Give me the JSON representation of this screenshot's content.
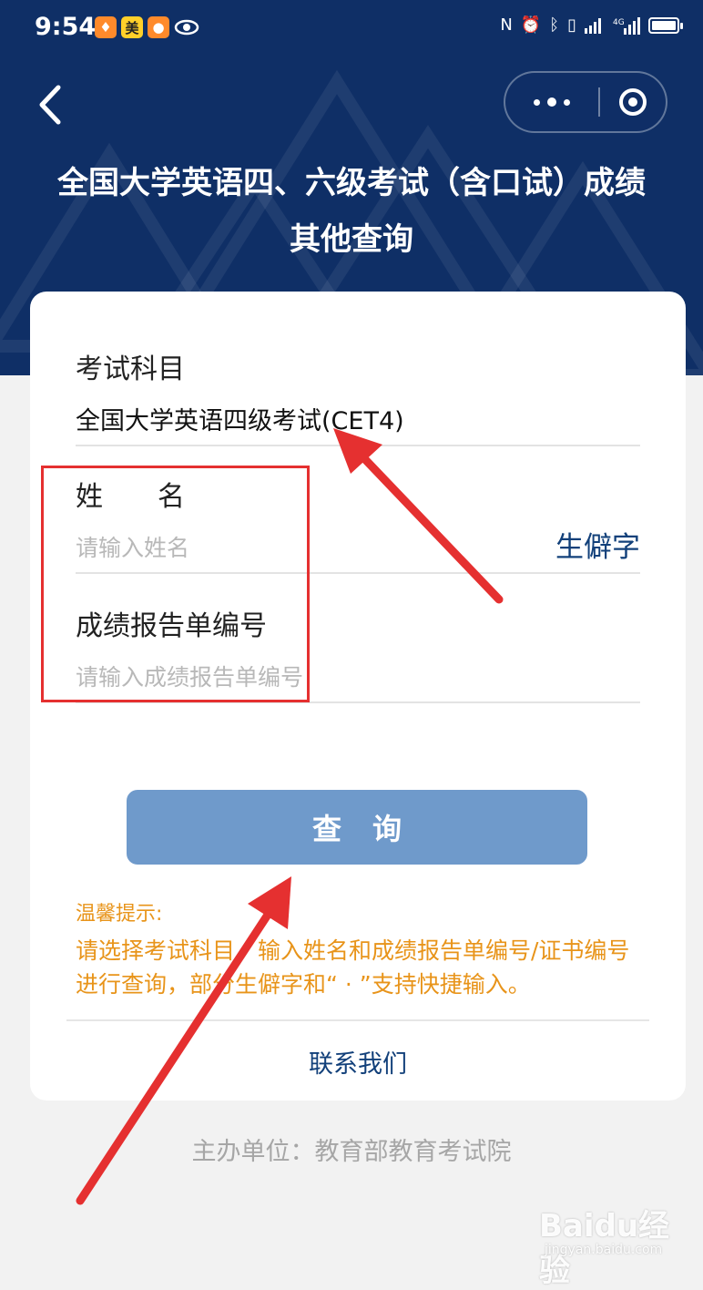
{
  "status_bar": {
    "time": "9:54",
    "app_badges": [
      "♦",
      "美",
      "●"
    ],
    "icons": [
      "eye-icon",
      "nfc-icon",
      "alarm-icon",
      "bluetooth-icon",
      "vibrate-icon",
      "signal-icon",
      "4g-signal-icon",
      "battery-icon"
    ]
  },
  "nav": {
    "back_icon": "chevron-left-icon",
    "more_icon": "more-dots-icon",
    "close_icon": "target-icon"
  },
  "header": {
    "title_line1": "全国大学英语四、六级考试（含口试）成绩",
    "title_line2": "其他查询"
  },
  "form": {
    "subject_label": "考试科目",
    "subject_value": "全国大学英语四级考试(CET4)",
    "name_label": "姓　　名",
    "name_placeholder": "请输入姓名",
    "rare_char_button": "生僻字",
    "report_label": "成绩报告单编号",
    "report_placeholder": "请输入成绩报告单编号",
    "query_button": "查询"
  },
  "tips": {
    "title": "温馨提示:",
    "body": "请选择考试科目，输入姓名和成绩报告单编号/证书编号进行查询，部分生僻字和“ · ”支持快捷输入。"
  },
  "contact_link": "联系我们",
  "footer": "主办单位：教育部教育考试院",
  "watermark": {
    "brand": "Baidu经验",
    "sub": "jingyan.baidu.com"
  },
  "colors": {
    "header_bg": "#0f2f66",
    "accent_link": "#12407a",
    "query_button": "#6f9acb",
    "tip_text": "#e8941a",
    "annotation_red": "#e53030"
  }
}
